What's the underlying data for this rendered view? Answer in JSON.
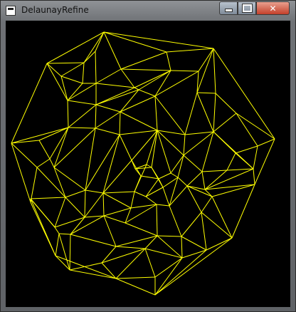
{
  "window": {
    "title": "DelaunayRefine",
    "icon": "app-window-icon",
    "controls": [
      "minimize",
      "maximize",
      "close"
    ]
  },
  "canvas": {
    "background": "#000000",
    "line_color": "#ffff00"
  }
}
